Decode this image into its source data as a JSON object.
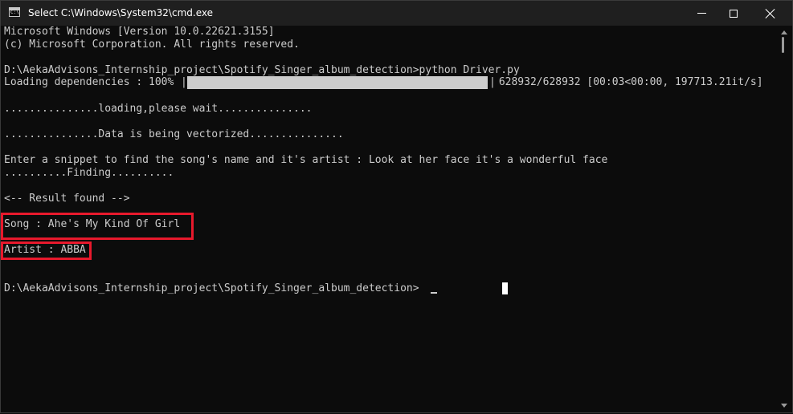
{
  "window": {
    "title": "Select C:\\Windows\\System32\\cmd.exe",
    "icon": "cmd-icon"
  },
  "console": {
    "lines": {
      "l1": "Microsoft Windows [Version 10.0.22621.3155]",
      "l2": "(c) Microsoft Corporation. All rights reserved.",
      "l3": "D:\\AekaAdvisons_Internship_project\\Spotify_Singer_album_detection>python Driver.py",
      "l4_prefix": "Loading dependencies : 100%",
      "l4_suffix": " 628932/628932 [00:03<00:00, 197713.21it/s]",
      "l5": "...............loading,please wait...............",
      "l6": "...............Data is being vectorized...............",
      "l7": "Enter a snippet to find the song's name and it's artist : Look at her face it's a wonderful face",
      "l8": "..........Finding..........",
      "l9": "<-- Result found -->",
      "l10": "Song : Ahe's My Kind Of Girl",
      "l11": "Artist : ABBA",
      "l12": "D:\\AekaAdvisons_Internship_project\\Spotify_Singer_album_detection>"
    },
    "progress_percent": 100,
    "pipe": "|"
  },
  "colors": {
    "background": "#0c0c0c",
    "text": "#cccccc",
    "highlight": "#e8192c",
    "titlebar": "#1f1f1f"
  }
}
